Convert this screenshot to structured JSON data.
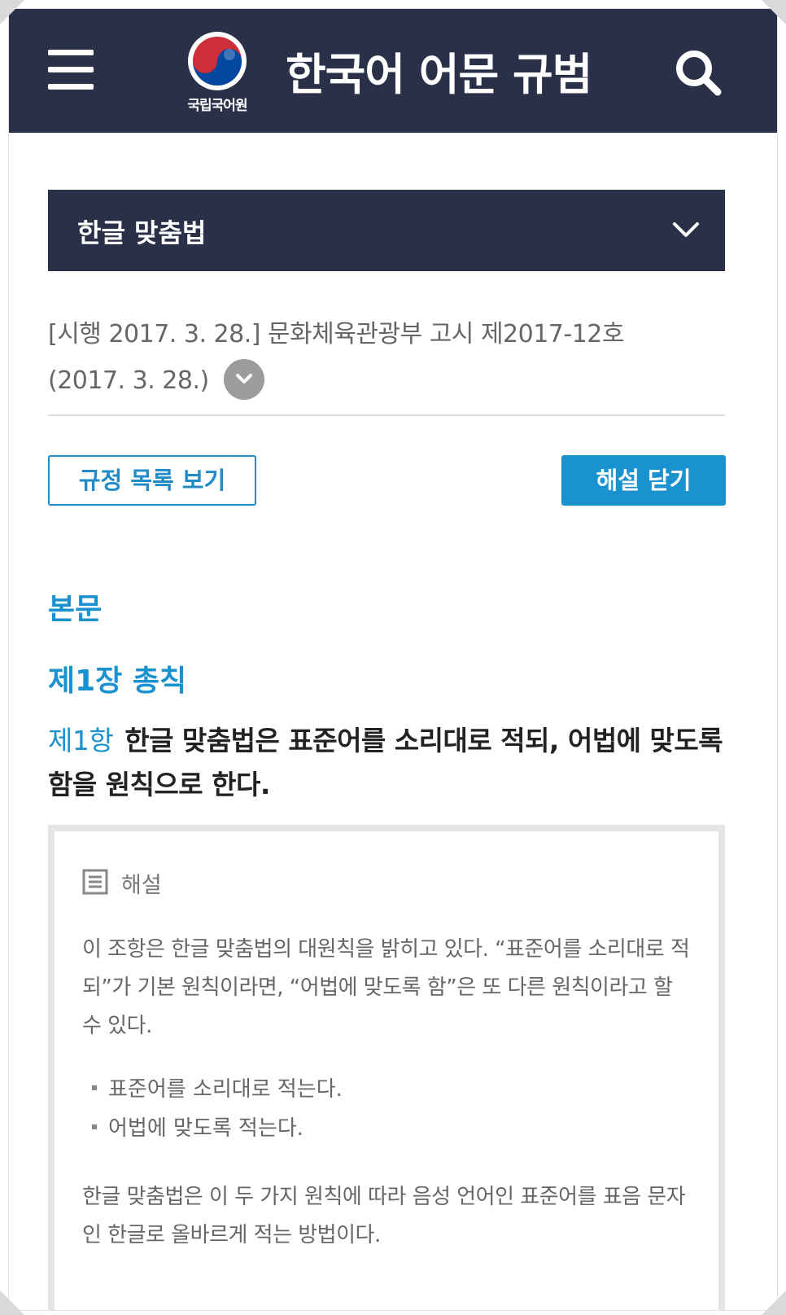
{
  "header": {
    "menu_icon": "hamburger-menu-icon",
    "logo_text": "국립국어원",
    "title": "한국어 어문 규범",
    "search_icon": "search-icon",
    "colors": {
      "background": "#2b3049"
    }
  },
  "category_select": {
    "selected": "한글 맞춤법",
    "chevron_icon": "chevron-down-icon"
  },
  "notice": {
    "line1": "[시행 2017. 3. 28.] 문화체육관광부 고시 제2017-12호",
    "line2": "(2017. 3. 28.)",
    "toggle_icon": "chevron-down-circle-icon"
  },
  "actions": {
    "list_button": "규정 목록 보기",
    "close_commentary_button": "해설 닫기",
    "accent_color": "#1a92cf"
  },
  "content": {
    "section_heading": "본문",
    "chapter_heading": "제1장 총칙",
    "clause_number": "제1항",
    "clause_text": "한글 맞춤법은 표준어를 소리대로 적되, 어법에 맞도록 함을 원칙으로 한다."
  },
  "commentary": {
    "heading": "해설",
    "heading_icon": "document-icon",
    "paragraph1": "이 조항은 한글 맞춤법의 대원칙을 밝히고 있다. “표준어를 소리대로 적되”가 기본 원칙이라면, “어법에 맞도록 함”은 또 다른 원칙이라고 할 수 있다.",
    "bullets": [
      "표준어를 소리대로 적는다.",
      "어법에 맞도록 적는다."
    ],
    "paragraph2": "한글 맞춤법은 이 두 가지 원칙에 따라 음성 언어인 표준어를 표음 문자인 한글로 올바르게 적는 방법이다."
  }
}
